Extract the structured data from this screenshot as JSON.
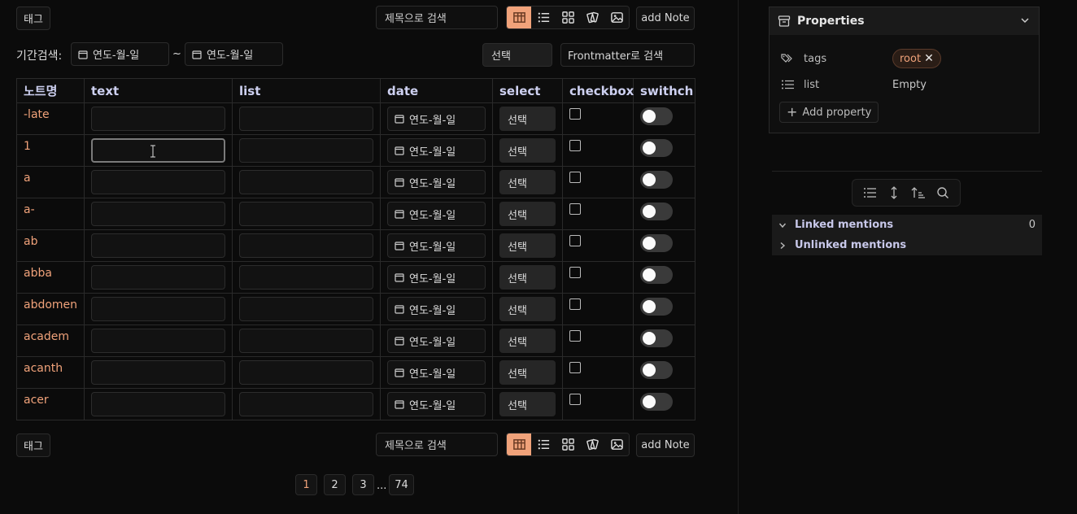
{
  "toolbar_top": {
    "tag_button": "태그",
    "search_placeholder": "제목으로 검색",
    "add_note": "add Note"
  },
  "filter": {
    "period_label": "기간검색:",
    "date_from": "연도-월-일",
    "tilde": "~",
    "date_to": "연도-월-일",
    "select_label": "선택",
    "frontmatter_placeholder": "Frontmatter로 검색"
  },
  "table": {
    "columns": [
      "노트명",
      "text",
      "list",
      "date",
      "select",
      "checkbox",
      "swithch"
    ],
    "date_placeholder": "연도-월-일",
    "select_placeholder": "선택",
    "rows": [
      {
        "name": "-late"
      },
      {
        "name": "1"
      },
      {
        "name": "a"
      },
      {
        "name": "a-"
      },
      {
        "name": "ab"
      },
      {
        "name": "abba"
      },
      {
        "name": "abdomen"
      },
      {
        "name": "academ"
      },
      {
        "name": "acanth"
      },
      {
        "name": "acer"
      }
    ]
  },
  "toolbar_bottom": {
    "tag_button": "태그",
    "search_placeholder": "제목으로 검색",
    "add_note": "add Note"
  },
  "pagination": {
    "pages": [
      "1",
      "2",
      "3"
    ],
    "ellipsis": "...",
    "last": "74",
    "current": "1"
  },
  "properties": {
    "title": "Properties",
    "tags_label": "tags",
    "tag_value": "root",
    "list_label": "list",
    "list_value": "Empty",
    "add_property": "Add property"
  },
  "mentions": {
    "linked_label": "Linked mentions",
    "linked_count": "0",
    "unlinked_label": "Unlinked mentions"
  },
  "colors": {
    "accent": "#f0a27a",
    "background": "#0b0b0b",
    "header_text": "#cdd0f0"
  }
}
